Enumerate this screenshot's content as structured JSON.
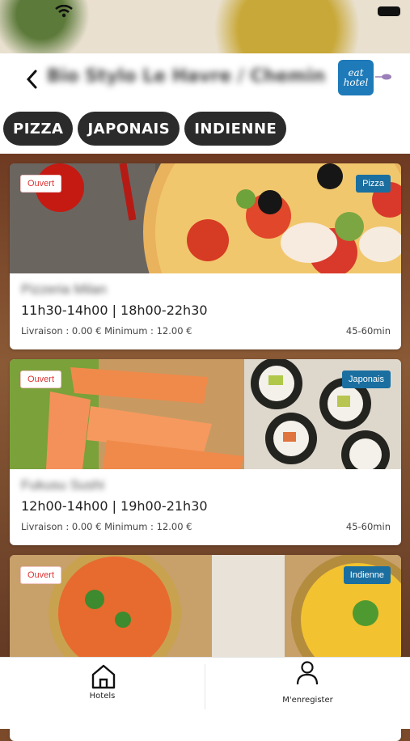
{
  "header": {
    "title": "Bio Stylo Le Havre / Chemin",
    "logo": {
      "line1": "eat",
      "line2": "hotel"
    }
  },
  "categories": [
    "PIZZA",
    "JAPONAIS",
    "INDIENNE"
  ],
  "restaurants": [
    {
      "status": "Ouvert",
      "category": "Pizza",
      "name": "Pizzeria Milan",
      "hours": "11h30-14h00 | 18h00-22h30",
      "delivery": "Livraison : 0.00 € Minimum : 12.00 €",
      "eta": "45-60min"
    },
    {
      "status": "Ouvert",
      "category": "Japonais",
      "name": "Fukusu Sushi",
      "hours": "12h00-14h00 | 19h00-21h30",
      "delivery": "Livraison : 0.00 € Minimum : 12.00 €",
      "eta": "45-60min"
    },
    {
      "status": "Ouvert",
      "category": "Indienne"
    }
  ],
  "nav": [
    {
      "label": "Hotels",
      "icon": "home-icon"
    },
    {
      "label": "M'enregister",
      "icon": "user-icon"
    }
  ],
  "colors": {
    "chip_bg": "#2b2b2b",
    "badge_cat": "#1a6fa0",
    "badge_open_text": "#dd3333"
  }
}
